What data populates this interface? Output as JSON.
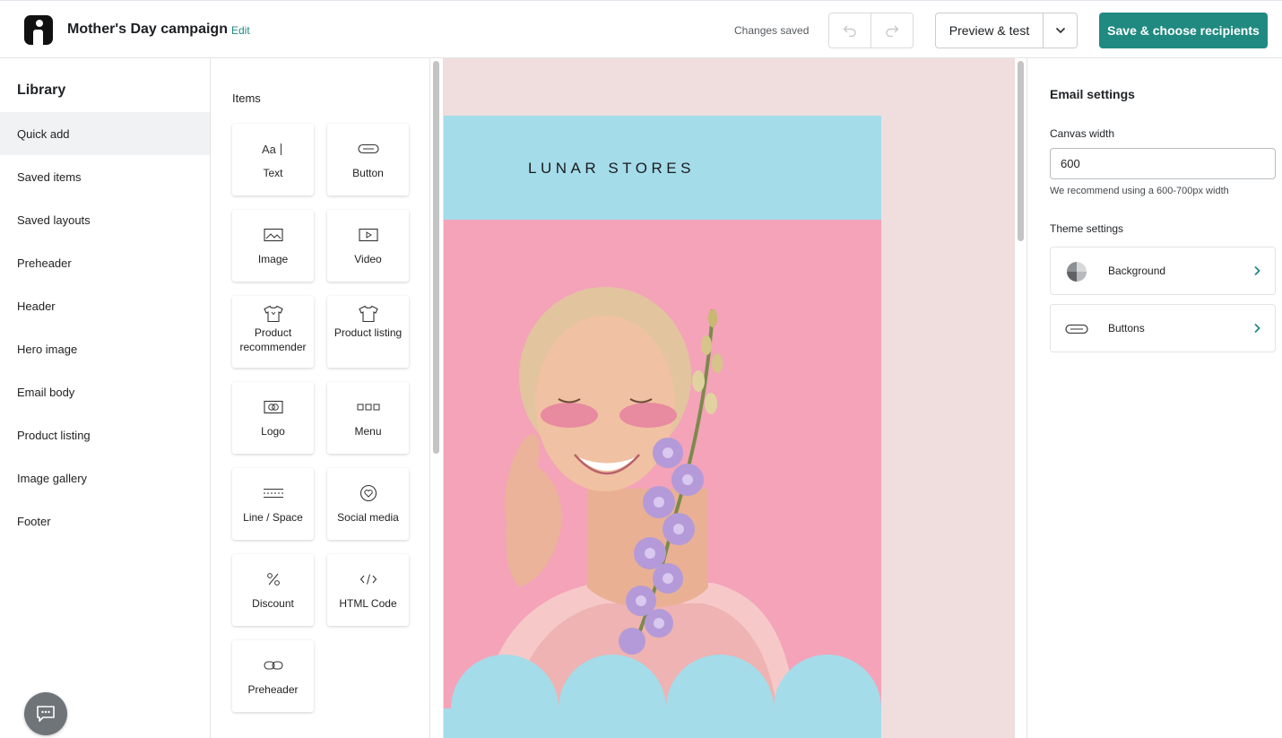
{
  "header": {
    "campaign_title": "Mother's Day campaign",
    "edit_label": "Edit",
    "status": "Changes saved",
    "preview_label": "Preview & test",
    "save_label": "Save & choose recipients"
  },
  "library": {
    "title": "Library",
    "items": [
      {
        "label": "Quick add",
        "active": true
      },
      {
        "label": "Saved items"
      },
      {
        "label": "Saved layouts"
      },
      {
        "label": "Preheader"
      },
      {
        "label": "Header"
      },
      {
        "label": "Hero image"
      },
      {
        "label": "Email body"
      },
      {
        "label": "Product listing"
      },
      {
        "label": "Image gallery"
      },
      {
        "label": "Footer"
      }
    ]
  },
  "items_panel": {
    "title": "Items",
    "items": [
      {
        "label": "Text",
        "icon": "text-icon"
      },
      {
        "label": "Button",
        "icon": "button-icon"
      },
      {
        "label": "Image",
        "icon": "image-icon"
      },
      {
        "label": "Video",
        "icon": "video-icon"
      },
      {
        "label": "Product recommender",
        "icon": "shirt-icon"
      },
      {
        "label": "Product listing",
        "icon": "shirt-icon"
      },
      {
        "label": "Logo",
        "icon": "logo-icon"
      },
      {
        "label": "Menu",
        "icon": "menu-icon"
      },
      {
        "label": "Line / Space",
        "icon": "line-space-icon"
      },
      {
        "label": "Social media",
        "icon": "social-heart-icon"
      },
      {
        "label": "Discount",
        "icon": "percent-icon"
      },
      {
        "label": "HTML Code",
        "icon": "code-icon"
      },
      {
        "label": "Preheader",
        "icon": "link-icon"
      }
    ]
  },
  "email": {
    "brand_name": "LUNAR STORES",
    "colors": {
      "background": "#efdedd",
      "header": "#a4dcea",
      "hero": "#f4a3b9"
    }
  },
  "settings": {
    "title": "Email settings",
    "canvas_width_label": "Canvas width",
    "canvas_width_value": "600",
    "canvas_width_hint": "We recommend using a 600-700px width",
    "theme_label": "Theme settings",
    "theme_items": [
      {
        "label": "Background",
        "icon": "background-icon"
      },
      {
        "label": "Buttons",
        "icon": "buttons-icon"
      }
    ]
  },
  "colors": {
    "accent": "#208a80",
    "link": "#1d8a82"
  }
}
